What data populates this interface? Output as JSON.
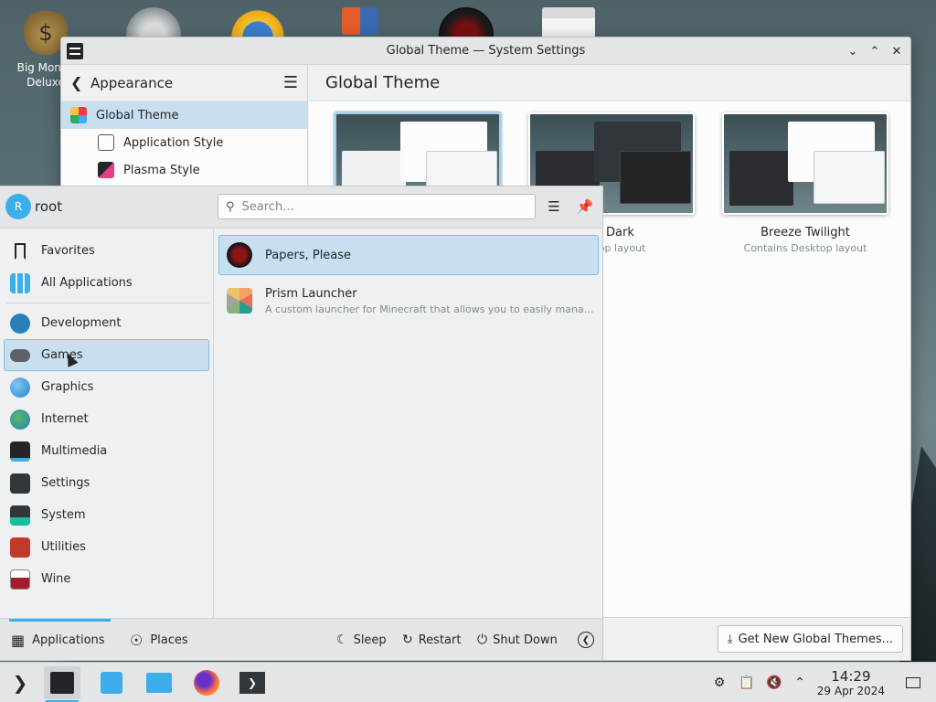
{
  "desktop": {
    "icon_label": "Big Money Deluxe"
  },
  "window": {
    "title": "Global Theme — System Settings",
    "sidebar": {
      "back_label": "Appearance",
      "items": [
        {
          "label": "Global Theme"
        },
        {
          "label": "Application Style"
        },
        {
          "label": "Plasma Style"
        }
      ]
    },
    "page_title": "Global Theme",
    "themes": [
      {
        "name": "",
        "desc": ""
      },
      {
        "name": "ze Dark",
        "desc": "esktop layout"
      },
      {
        "name": "Breeze Twilight",
        "desc": "Contains Desktop layout"
      }
    ],
    "get_new_button": "Get New Global Themes..."
  },
  "launcher": {
    "avatar_initial": "R",
    "username": "root",
    "search_placeholder": "Search...",
    "categories": [
      {
        "label": "Favorites"
      },
      {
        "label": "All Applications"
      },
      {
        "label": "Development"
      },
      {
        "label": "Games"
      },
      {
        "label": "Graphics"
      },
      {
        "label": "Internet"
      },
      {
        "label": "Multimedia"
      },
      {
        "label": "Settings"
      },
      {
        "label": "System"
      },
      {
        "label": "Utilities"
      },
      {
        "label": "Wine"
      }
    ],
    "apps": [
      {
        "name": "Papers, Please",
        "desc": ""
      },
      {
        "name": "Prism Launcher",
        "desc": "A custom launcher for Minecraft that allows you to easily manage ..."
      }
    ],
    "tabs": {
      "applications": "Applications",
      "places": "Places"
    },
    "power": {
      "sleep": "Sleep",
      "restart": "Restart",
      "shutdown": "Shut Down"
    }
  },
  "taskbar": {
    "time": "14:29",
    "date": "29 Apr 2024"
  },
  "colors": {
    "accent": "#3daee9",
    "selection": "#c8dff0"
  }
}
